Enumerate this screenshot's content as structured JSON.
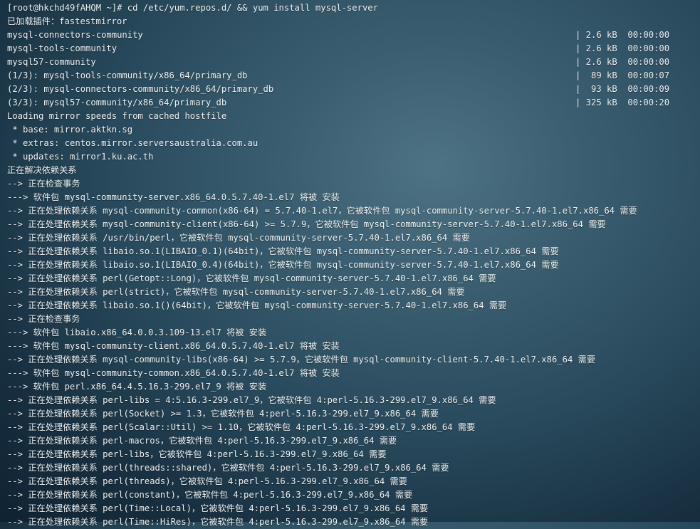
{
  "terminal": {
    "lines": [
      {
        "text": "[root@hkchd49fAHQM ~]# cd /etc/yum.repos.d/ && yum install mysql-server"
      },
      {
        "text": "已加载插件：fastestmirror"
      },
      {
        "text": "mysql-connectors-community",
        "right": "| 2.6 kB  00:00:00"
      },
      {
        "text": "mysql-tools-community",
        "right": "| 2.6 kB  00:00:00"
      },
      {
        "text": "mysql57-community",
        "right": "| 2.6 kB  00:00:00"
      },
      {
        "text": "(1/3): mysql-tools-community/x86_64/primary_db",
        "right": "|  89 kB  00:00:07"
      },
      {
        "text": "(2/3): mysql-connectors-community/x86_64/primary_db",
        "right": "|  93 kB  00:00:09"
      },
      {
        "text": "(3/3): mysql57-community/x86_64/primary_db",
        "right": "| 325 kB  00:00:20"
      },
      {
        "text": "Loading mirror speeds from cached hostfile"
      },
      {
        "text": " * base: mirror.aktkn.sg"
      },
      {
        "text": " * extras: centos.mirror.serversaustralia.com.au"
      },
      {
        "text": " * updates: mirror1.ku.ac.th"
      },
      {
        "text": "正在解决依赖关系"
      },
      {
        "text": "--> 正在检查事务"
      },
      {
        "text": "---> 软件包 mysql-community-server.x86_64.0.5.7.40-1.el7 将被 安装"
      },
      {
        "text": "--> 正在处理依赖关系 mysql-community-common(x86-64) = 5.7.40-1.el7，它被软件包 mysql-community-server-5.7.40-1.el7.x86_64 需要"
      },
      {
        "text": "--> 正在处理依赖关系 mysql-community-client(x86-64) >= 5.7.9，它被软件包 mysql-community-server-5.7.40-1.el7.x86_64 需要"
      },
      {
        "text": "--> 正在处理依赖关系 /usr/bin/perl，它被软件包 mysql-community-server-5.7.40-1.el7.x86_64 需要"
      },
      {
        "text": "--> 正在处理依赖关系 libaio.so.1(LIBAIO_0.1)(64bit)，它被软件包 mysql-community-server-5.7.40-1.el7.x86_64 需要"
      },
      {
        "text": "--> 正在处理依赖关系 libaio.so.1(LIBAIO_0.4)(64bit)，它被软件包 mysql-community-server-5.7.40-1.el7.x86_64 需要"
      },
      {
        "text": "--> 正在处理依赖关系 perl(Getopt::Long)，它被软件包 mysql-community-server-5.7.40-1.el7.x86_64 需要"
      },
      {
        "text": "--> 正在处理依赖关系 perl(strict)，它被软件包 mysql-community-server-5.7.40-1.el7.x86_64 需要"
      },
      {
        "text": "--> 正在处理依赖关系 libaio.so.1()(64bit)，它被软件包 mysql-community-server-5.7.40-1.el7.x86_64 需要"
      },
      {
        "text": "--> 正在检查事务"
      },
      {
        "text": "---> 软件包 libaio.x86_64.0.0.3.109-13.el7 将被 安装"
      },
      {
        "text": "---> 软件包 mysql-community-client.x86_64.0.5.7.40-1.el7 将被 安装"
      },
      {
        "text": "--> 正在处理依赖关系 mysql-community-libs(x86-64) >= 5.7.9，它被软件包 mysql-community-client-5.7.40-1.el7.x86_64 需要"
      },
      {
        "text": "---> 软件包 mysql-community-common.x86_64.0.5.7.40-1.el7 将被 安装"
      },
      {
        "text": "---> 软件包 perl.x86_64.4.5.16.3-299.el7_9 将被 安装"
      },
      {
        "text": "--> 正在处理依赖关系 perl-libs = 4:5.16.3-299.el7_9，它被软件包 4:perl-5.16.3-299.el7_9.x86_64 需要"
      },
      {
        "text": "--> 正在处理依赖关系 perl(Socket) >= 1.3，它被软件包 4:perl-5.16.3-299.el7_9.x86_64 需要"
      },
      {
        "text": "--> 正在处理依赖关系 perl(Scalar::Util) >= 1.10，它被软件包 4:perl-5.16.3-299.el7_9.x86_64 需要"
      },
      {
        "text": "--> 正在处理依赖关系 perl-macros，它被软件包 4:perl-5.16.3-299.el7_9.x86_64 需要"
      },
      {
        "text": "--> 正在处理依赖关系 perl-libs，它被软件包 4:perl-5.16.3-299.el7_9.x86_64 需要"
      },
      {
        "text": "--> 正在处理依赖关系 perl(threads::shared)，它被软件包 4:perl-5.16.3-299.el7_9.x86_64 需要"
      },
      {
        "text": "--> 正在处理依赖关系 perl(threads)，它被软件包 4:perl-5.16.3-299.el7_9.x86_64 需要"
      },
      {
        "text": "--> 正在处理依赖关系 perl(constant)，它被软件包 4:perl-5.16.3-299.el7_9.x86_64 需要"
      },
      {
        "text": "--> 正在处理依赖关系 perl(Time::Local)，它被软件包 4:perl-5.16.3-299.el7_9.x86_64 需要"
      },
      {
        "text": "--> 正在处理依赖关系 perl(Time::HiRes)，它被软件包 4:perl-5.16.3-299.el7_9.x86_64 需要"
      }
    ]
  }
}
